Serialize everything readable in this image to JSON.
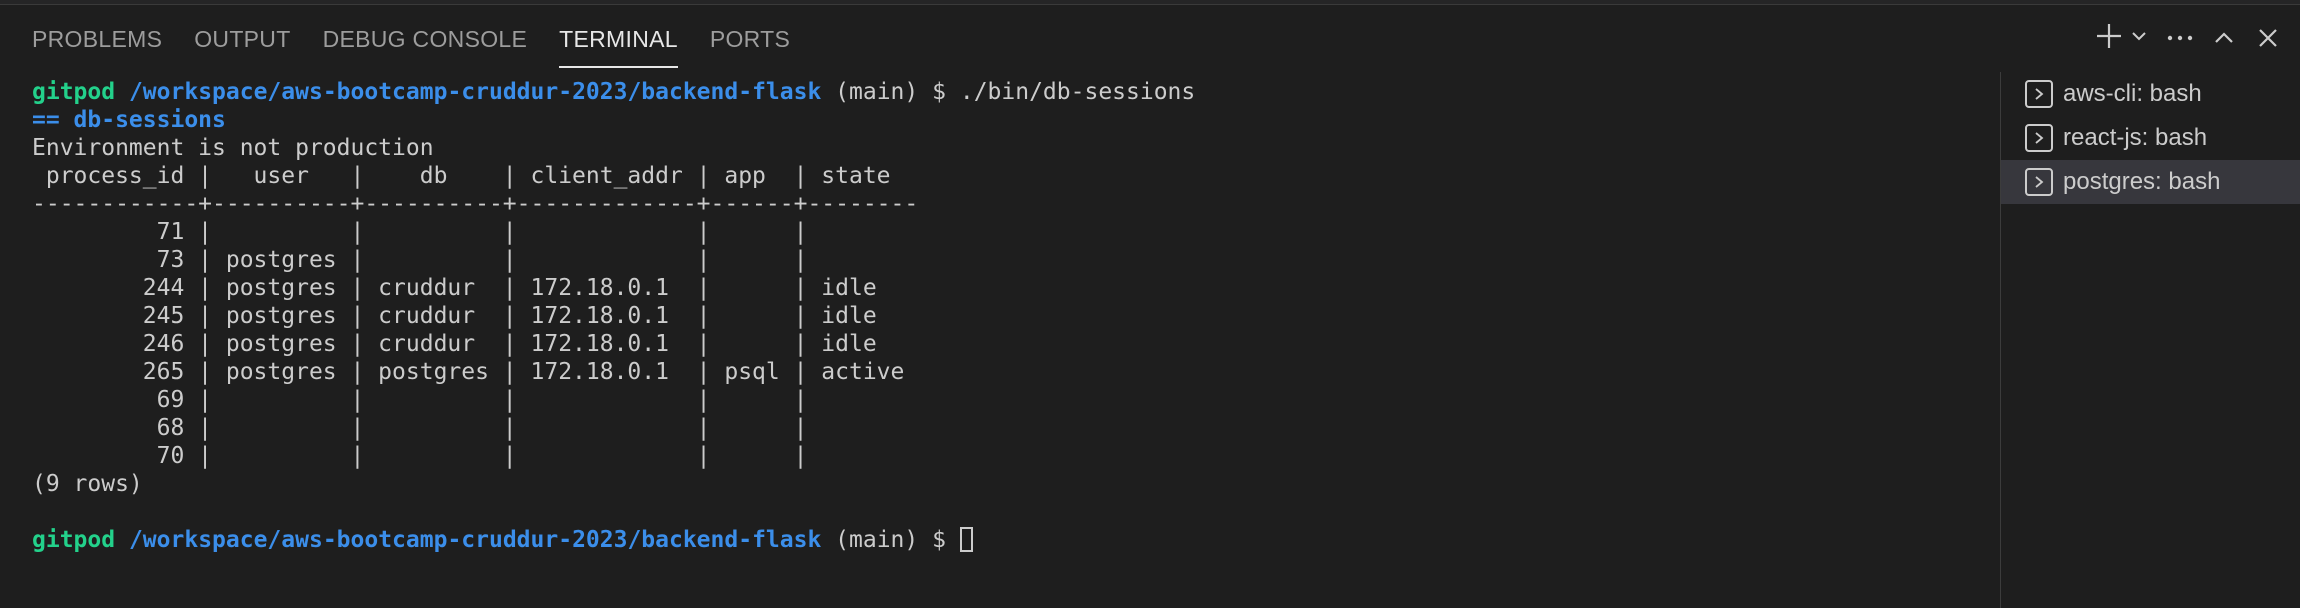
{
  "panel": {
    "tabs": [
      {
        "label": "PROBLEMS"
      },
      {
        "label": "OUTPUT"
      },
      {
        "label": "DEBUG CONSOLE"
      },
      {
        "label": "TERMINAL"
      },
      {
        "label": "PORTS"
      }
    ],
    "active_tab": "TERMINAL",
    "actions": [
      "plus-icon",
      "chevron-down-icon",
      "ellipsis-icon",
      "chevron-up-icon",
      "close-icon"
    ]
  },
  "terminal": {
    "prompt": {
      "user": "gitpod",
      "path": "/workspace/aws-bootcamp-cruddur-2023/backend-flask",
      "branch": "(main)",
      "symbol": "$"
    },
    "command": "./bin/db-sessions",
    "script_header": "== db-sessions",
    "env_message": "Environment is not production",
    "table_header": " process_id |   user   |    db    | client_addr | app  | state",
    "table_divider": "------------+----------+----------+-------------+------+--------",
    "rows": [
      "         71 |          |          |             |      |",
      "         73 | postgres |          |             |      |",
      "        244 | postgres | cruddur  | 172.18.0.1  |      | idle",
      "        245 | postgres | cruddur  | 172.18.0.1  |      | idle",
      "        246 | postgres | cruddur  | 172.18.0.1  |      | idle",
      "        265 | postgres | postgres | 172.18.0.1  | psql | active",
      "         69 |          |          |             |      |",
      "         68 |          |          |             |      |",
      "         70 |          |          |             |      |"
    ],
    "row_count": "(9 rows)"
  },
  "terminal_tabs": [
    {
      "label": "aws-cli: bash",
      "icon": "terminal-icon"
    },
    {
      "label": "react-js: bash",
      "icon": "terminal-icon"
    },
    {
      "label": "postgres: bash",
      "icon": "terminal-icon",
      "active": true
    }
  ],
  "colors": {
    "background": "#1e1e1e",
    "prompt_user": "#23d18b",
    "prompt_path": "#3b8eea",
    "script_header": "#3b8eea",
    "text": "#cccccc"
  }
}
